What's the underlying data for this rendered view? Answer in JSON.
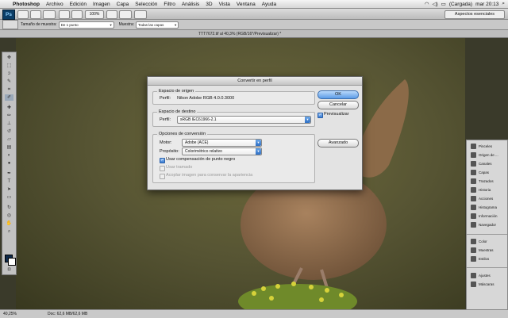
{
  "menubar": {
    "app": "Photoshop",
    "items": [
      "Archivo",
      "Edición",
      "Imagen",
      "Capa",
      "Selección",
      "Filtro",
      "Análisis",
      "3D",
      "Vista",
      "Ventana",
      "Ayuda"
    ],
    "battery": "(Cargada)",
    "clock": "mar 20:13"
  },
  "appbar": {
    "logo": "Ps",
    "zoom": "100%",
    "workspace": "Aspectos esenciales"
  },
  "options": {
    "sample_size_label": "Tamaño de muestra:",
    "sample_size_value": "De 1 punto",
    "sample_label": "Muestra:",
    "sample_value": "Todas las capas"
  },
  "document": {
    "tab_title": "TTT7672.tif al 40,3% (RGB/16*/Previsualizar) *"
  },
  "status": {
    "zoom": "40,25%",
    "doc": "Doc: 62,6 MB/62,6 MB"
  },
  "panels": {
    "group1": [
      "Pinceles",
      "Origen de ...",
      "Canales",
      "Capas",
      "Trazados",
      "Historia",
      "Acciones",
      "Histograma",
      "Información",
      "Navegador"
    ],
    "group2": [
      "Color",
      "Muestras",
      "Estilos"
    ],
    "group3": [
      "Ajustes",
      "Máscaras"
    ]
  },
  "dialog": {
    "title": "Convertir en perfil",
    "source_legend": "Espacio de origen",
    "source_profile_label": "Perfil:",
    "source_profile": "Nikon Adobe RGB 4.0.0.3000",
    "dest_legend": "Espacio de destino",
    "dest_profile_label": "Perfil:",
    "dest_profile": "sRGB IEC61966-2.1",
    "conv_legend": "Opciones de conversión",
    "engine_label": "Motor:",
    "engine": "Adobe (ACE)",
    "intent_label": "Propósito:",
    "intent": "Colorimétrico relativo",
    "black_point": "Usar compensación de punto negro",
    "dither": "Usar tramado",
    "flatten": "Acoplar imagen para conservar la apariencia",
    "ok": "OK",
    "cancel": "Cancelar",
    "preview": "Previsualizar",
    "advanced": "Avanzado"
  }
}
